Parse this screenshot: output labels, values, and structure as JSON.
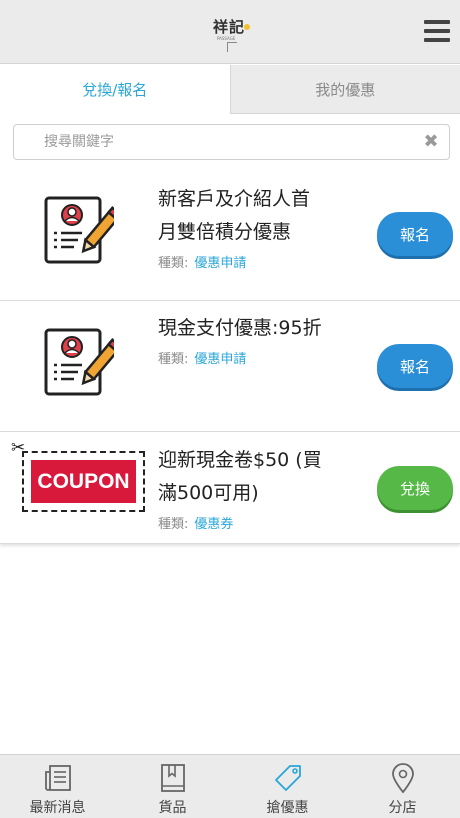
{
  "header": {
    "logo_text": "祥記",
    "logo_subtitle": "PASSAGE"
  },
  "tabs": [
    {
      "label": "兌換/報名",
      "active": true
    },
    {
      "label": "我的優惠",
      "active": false
    }
  ],
  "search": {
    "placeholder": "搜尋關鍵字",
    "value": ""
  },
  "items": [
    {
      "title_line1": "新客戶及介紹人首",
      "title_line2": "月雙倍積分優惠",
      "meta_label": "種類:",
      "category": "優惠申請",
      "action": "報名",
      "icon": "application-form-icon"
    },
    {
      "title_line1": "現金支付優惠:95折",
      "title_line2": "",
      "meta_label": "種類:",
      "category": "優惠申請",
      "action": "報名",
      "icon": "application-form-icon"
    },
    {
      "title_line1": "迎新現金卷$50 (買",
      "title_line2": "滿500可用)",
      "meta_label": "種類:",
      "category": "優惠券",
      "action": "兌換",
      "icon": "coupon-icon",
      "coupon_text": "COUPON"
    }
  ],
  "bottom_nav": [
    {
      "label": "最新消息",
      "icon": "newspaper-icon"
    },
    {
      "label": "貨品",
      "icon": "book-icon"
    },
    {
      "label": "搶優惠",
      "icon": "tag-icon"
    },
    {
      "label": "分店",
      "icon": "map-pin-icon"
    }
  ],
  "colors": {
    "accent": "#2aa6d8",
    "signup_button": "#2b8fd8",
    "redeem_button": "#56b947",
    "coupon_red": "#d8193c",
    "pencil_orange": "#f0a434",
    "avatar_red": "#e0404a"
  }
}
